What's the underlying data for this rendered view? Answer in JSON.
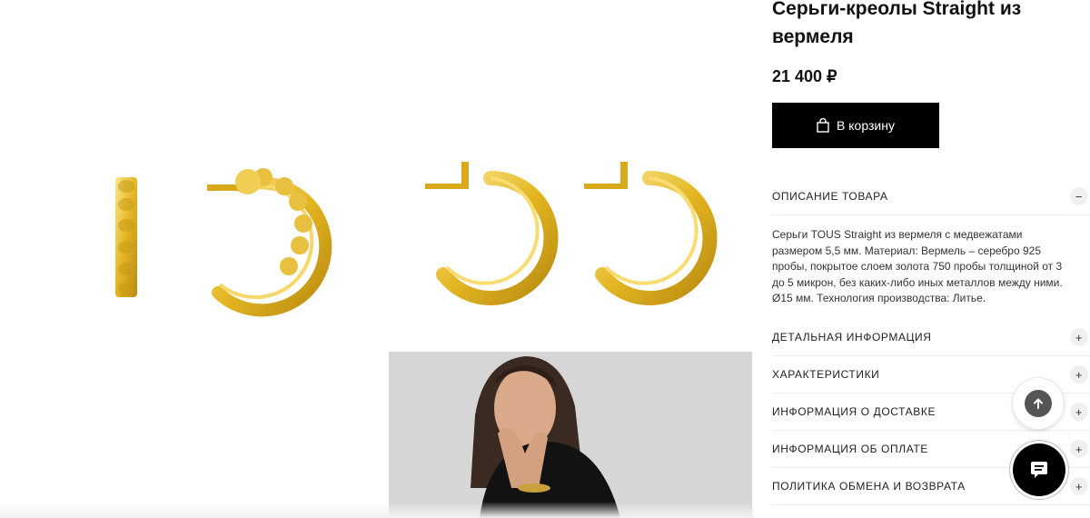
{
  "product": {
    "title": "Серьги-креолы Straight из вермеля",
    "price": "21 400 ₽",
    "add_to_cart_label": "В корзину"
  },
  "accordion": [
    {
      "label": "ОПИСАНИЕ ТОВАРА",
      "toggle": "−",
      "expanded": true
    },
    {
      "label": "ДЕТАЛЬНАЯ ИНФОРМАЦИЯ",
      "toggle": "+"
    },
    {
      "label": "ХАРАКТЕРИСТИКИ",
      "toggle": "+"
    },
    {
      "label": "ИНФОРМАЦИЯ О ДОСТАВКЕ",
      "toggle": "+"
    },
    {
      "label": "ИНФОРМАЦИЯ ОБ ОПЛАТЕ",
      "toggle": "+"
    },
    {
      "label": "ПОЛИТИКА ОБМЕНА И ВОЗВРАТА",
      "toggle": "+"
    }
  ],
  "description": "Серьги TOUS Straight из вермеля с медвежатами размером 5,5 мм. Материал: Вермель – серебро 925 пробы, покрытое слоем золота 750 пробы толщиной от 3 до 5 микрон, без каких-либо иных металлов между ними. Ø15 мм. Технология производства: Литье.",
  "icons": {
    "zoom": "expand-icon",
    "cart": "shopping-bag-icon",
    "scroll_top": "arrow-up-icon",
    "chat": "chat-icon"
  },
  "colors": {
    "button_bg": "#000000",
    "gold": "#e3b521"
  }
}
